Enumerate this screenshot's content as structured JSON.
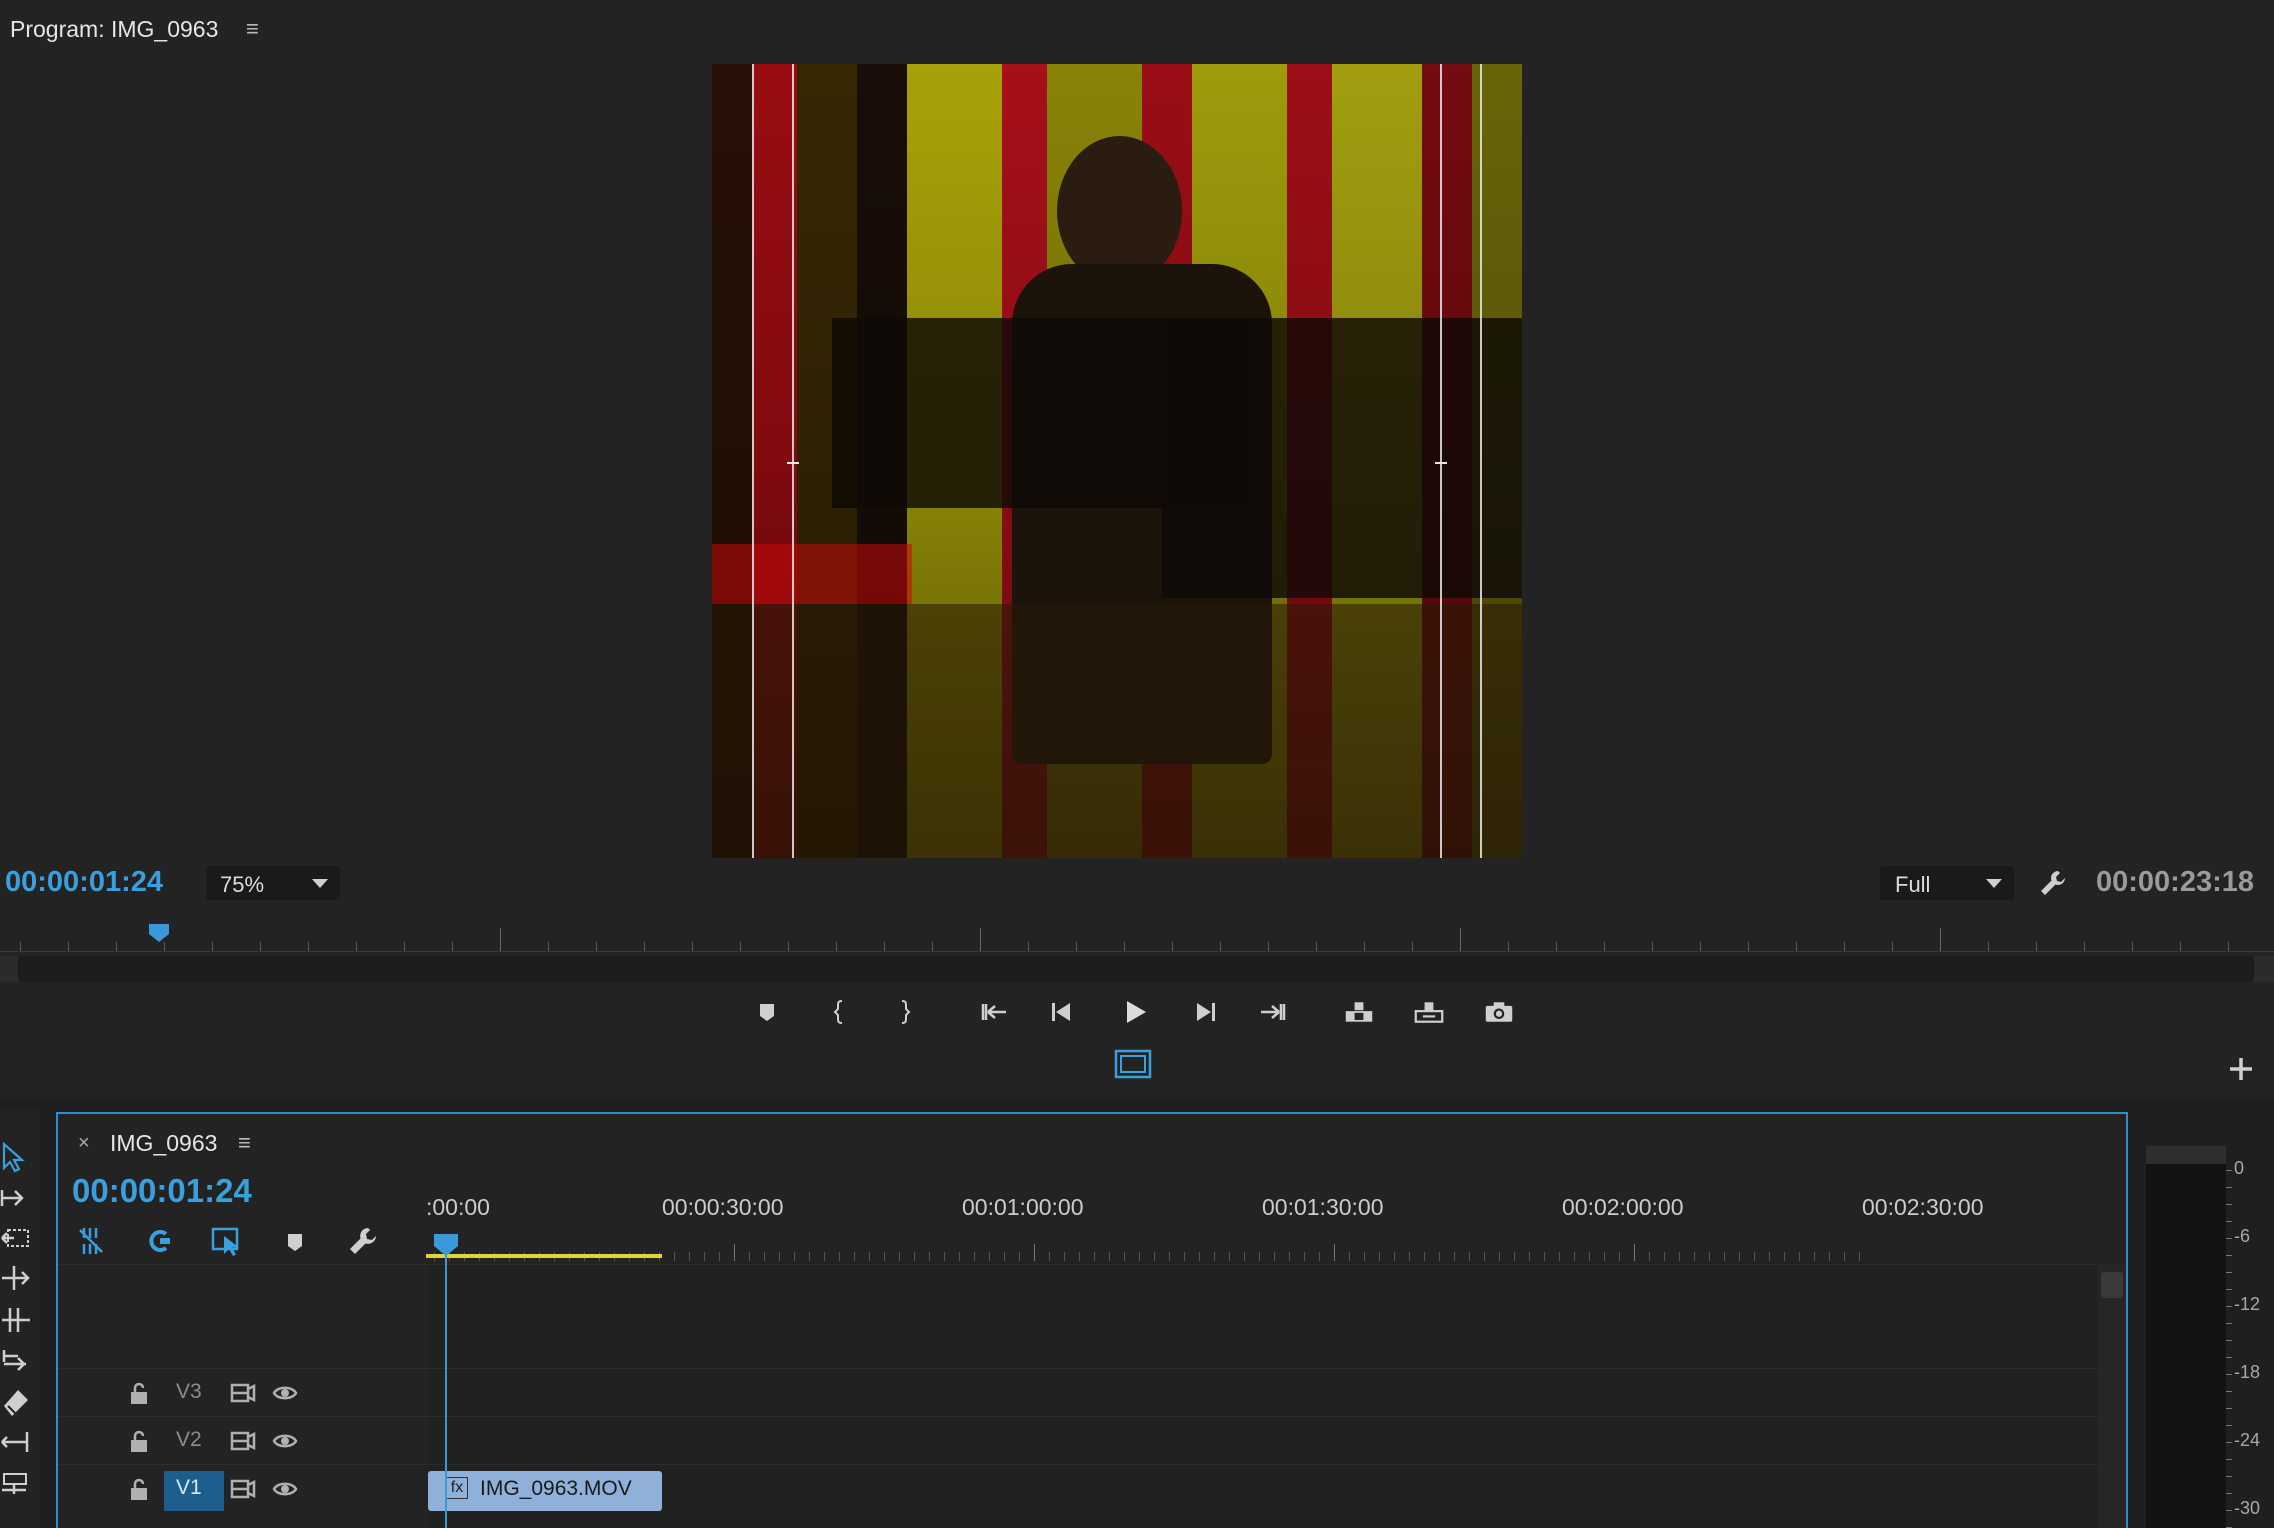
{
  "program_monitor": {
    "title": "Program: IMG_0963",
    "menu_icon": "hamburger-icon",
    "current_timecode": "00:00:01:24",
    "zoom": "75%",
    "resolution": "Full",
    "duration": "00:00:23:18",
    "playhead_position": 0.07,
    "transport_buttons": [
      "add-marker-icon",
      "mark-in-icon",
      "mark-out-icon",
      "go-to-in-icon",
      "step-back-icon",
      "play-icon",
      "step-forward-icon",
      "go-to-out-icon",
      "lift-icon",
      "extract-icon",
      "export-frame-icon"
    ],
    "safe_margins_icon": "safe-margins-icon",
    "add_button_icon": "plus-icon"
  },
  "tools": [
    "selection-tool-icon",
    "track-select-tool-icon",
    "ripple-edit-tool-icon",
    "rolling-edit-tool-icon",
    "rate-stretch-tool-icon",
    "razor-tool-icon",
    "slip-tool-icon",
    "slide-tool-icon",
    "pen-tool-icon"
  ],
  "timeline": {
    "close_label": "×",
    "sequence_name": "IMG_0963",
    "timecode": "00:00:01:24",
    "ruler_labels": [
      ":00:00",
      "00:00:30:00",
      "00:01:00:00",
      "00:01:30:00",
      "00:02:00:00",
      "00:02:30:00"
    ],
    "tool_icons": [
      "snap-icon",
      "linked-selection-icon",
      "insert-overwrite-icon",
      "add-marker-icon",
      "timeline-settings-icon"
    ],
    "tracks": [
      {
        "name": "V3",
        "locked": false,
        "visible": true
      },
      {
        "name": "V2",
        "locked": false,
        "visible": true
      },
      {
        "name": "V1",
        "locked": false,
        "visible": true,
        "targeted": true
      }
    ],
    "clip": {
      "name": "IMG_0963.MOV",
      "fx_badge": "fx"
    }
  },
  "audio_meter": {
    "scale": [
      "0",
      "-6",
      "-12",
      "-18",
      "-24",
      "-30"
    ]
  },
  "colors": {
    "accent": "#39a0dd",
    "panel": "#232323",
    "work_area": "#e2d33a",
    "clip": "#8fb0d8"
  }
}
